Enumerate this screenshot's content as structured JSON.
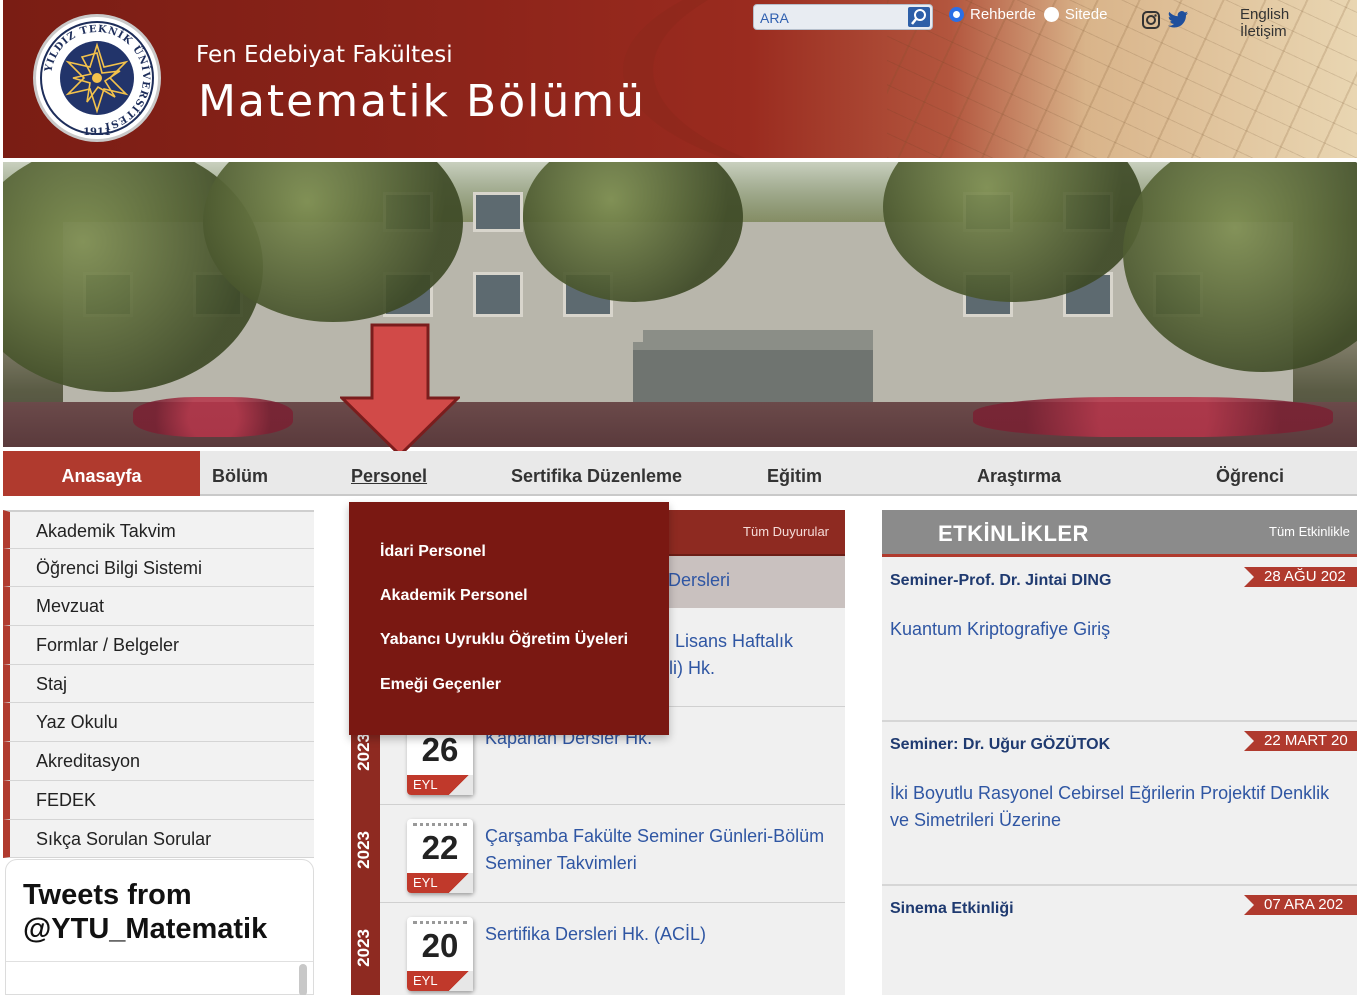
{
  "header": {
    "logo_text": "YILDIZ TEKNİK ÜNİVERSİTESİ",
    "logo_year": "1911",
    "faculty": "Fen Edebiyat Fakültesi",
    "department": "Matematik Bölümü"
  },
  "search": {
    "placeholder": "ARA",
    "options": [
      "Rehberde",
      "Sitede"
    ],
    "selected": "Rehberde"
  },
  "top_links": [
    "English",
    "İletişim"
  ],
  "nav": {
    "items": [
      "Anasayfa",
      "Bölüm",
      "Personel",
      "Sertifika Düzenleme",
      "Eğitim",
      "Araştırma",
      "Öğrenci"
    ],
    "active": "Anasayfa",
    "hovered": "Personel"
  },
  "sidebar": {
    "items": [
      "Akademik Takvim",
      "Öğrenci Bilgi Sistemi",
      "Mevzuat",
      "Formlar / Belgeler",
      "Staj",
      "Yaz Okulu",
      "Akreditasyon",
      "FEDEK",
      "Sıkça Sorulan Sorular"
    ]
  },
  "tweets": {
    "title_line1": "Tweets from",
    "title_line2": "@YTU_Matematik"
  },
  "dropdown": {
    "items": [
      "İdari Personel",
      "Akademik Personel",
      "Yabancı Uyruklu Öğretim Üyeleri",
      "Emeği Geçenler"
    ]
  },
  "announcements": {
    "all_label": "Tüm Duyurular",
    "partial_items": [
      "Dersleri",
      "Lisans Haftalık",
      "li) Hk.",
      "Kapanan Dersler Hk."
    ],
    "items": [
      {
        "year": "2023",
        "day": "26",
        "month": "EYL",
        "title": ""
      },
      {
        "year": "2023",
        "day": "22",
        "month": "EYL",
        "title": "Çarşamba Fakülte Seminer Günleri-Bölüm Seminer Takvimleri"
      },
      {
        "year": "2023",
        "day": "20",
        "month": "EYL",
        "title": "Sertifika Dersleri Hk. (ACİL)"
      }
    ]
  },
  "events": {
    "title": "ETKİNLİKLER",
    "all_label": "Tüm Etkinlikle",
    "items": [
      {
        "title": "Seminer-Prof. Dr. Jintai DING",
        "date": "28 AĞU 202",
        "desc": "Kuantum Kriptografiye Giriş"
      },
      {
        "title": "Seminer: Dr. Uğur GÖZÜTOK",
        "date": "22 MART 20",
        "desc": "İki Boyutlu Rasyonel Cebirsel Eğrilerin Projektif Denklik ve Simetrileri Üzerine"
      },
      {
        "title": "Sinema Etkinliği",
        "date": "07 ARA 202",
        "desc": ""
      }
    ]
  },
  "colors": {
    "brand": "#b03a2e",
    "dark_red": "#7a1812",
    "link": "#2f56a3"
  },
  "icons": [
    "search-icon",
    "instagram-icon",
    "twitter-icon",
    "down-arrow-annotation"
  ]
}
